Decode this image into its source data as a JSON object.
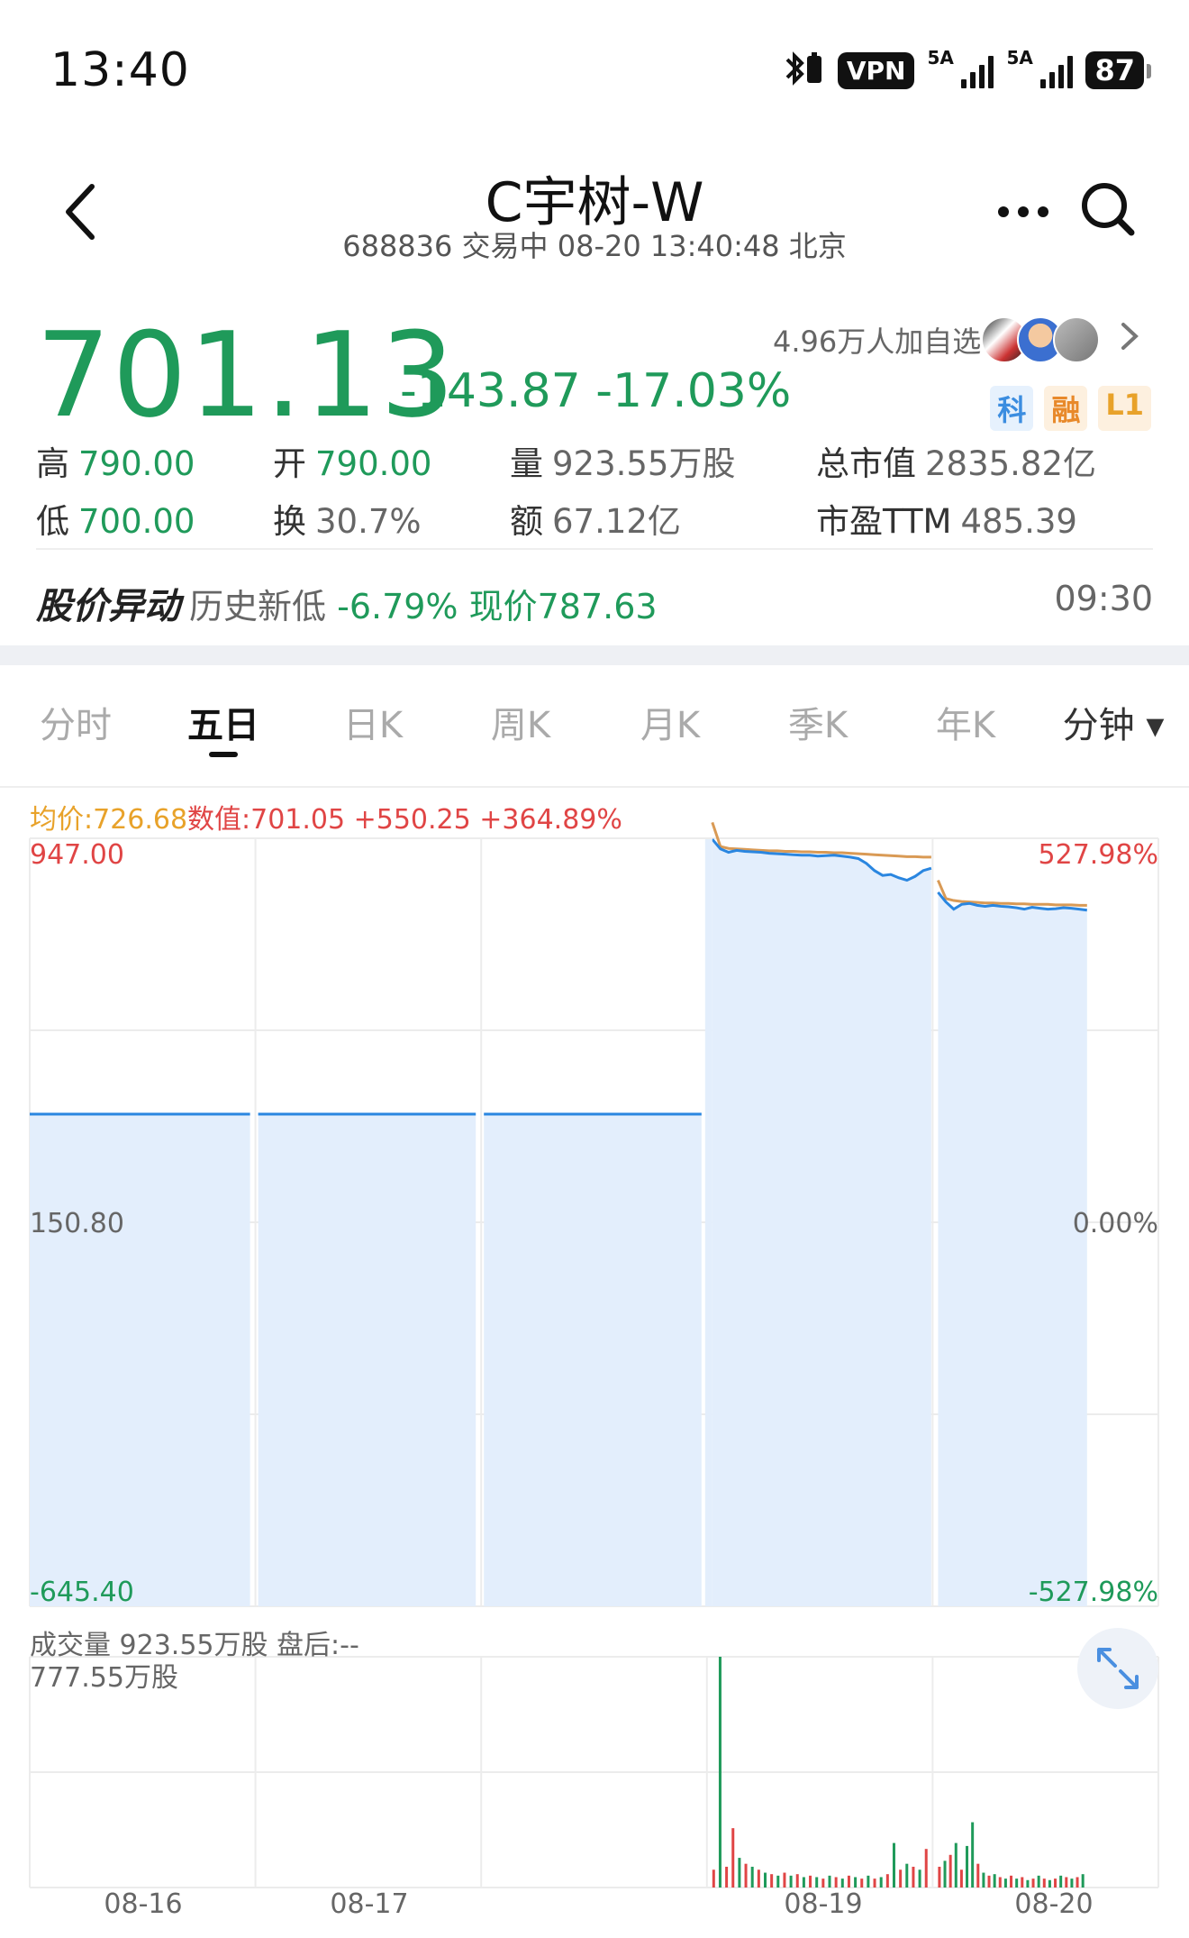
{
  "status_bar": {
    "time": "13:40",
    "vpn": "VPN",
    "signal1_label": "5A",
    "signal2_label": "5A",
    "battery": "87",
    "icons": [
      "bluetooth-icon",
      "vpn-icon",
      "signal-icon",
      "signal-icon",
      "battery-icon"
    ]
  },
  "header": {
    "title": "C宇树-W",
    "subtitle": "688836 交易中  08-20 13:40:48  北京"
  },
  "quote": {
    "price": "701.13",
    "change": "-143.87 -17.03%",
    "watch_count": "4.96万人加自选",
    "badges": [
      "科",
      "融",
      "L1"
    ],
    "stats": {
      "high_label": "高",
      "high_value": "790.00",
      "open_label": "开",
      "open_value": "790.00",
      "volume_label": "量",
      "volume_value": "923.55万股",
      "mktcap_label": "总市值",
      "mktcap_value": "2835.82亿",
      "low_label": "低",
      "low_value": "700.00",
      "turnover_label": "换",
      "turnover_value": "30.7%",
      "amount_label": "额",
      "amount_value": "67.12亿",
      "pe_label": "市盈TTM",
      "pe_value": "485.39"
    }
  },
  "alert": {
    "title": "股价异动",
    "text_gray": "历史新低",
    "text_green": "-6.79% 现价787.63",
    "time": "09:30"
  },
  "tabs": {
    "items": [
      "分时",
      "五日",
      "日K",
      "周K",
      "月K",
      "季K",
      "年K",
      "分钟 ▾"
    ],
    "active_index": 1
  },
  "chart_data": {
    "type": "line",
    "legend": {
      "avg": "均价:726.68",
      "value": "数值:701.05 +550.25 +364.89%"
    },
    "y_left_labels": {
      "top": "947.00",
      "mid": "150.80",
      "bottom": "-645.40"
    },
    "y_right_labels": {
      "top": "527.98%",
      "mid": "0.00%",
      "bottom": "-527.98%"
    },
    "ylim": [
      -645.4,
      947.0
    ],
    "colors": {
      "price": "#2a86e0",
      "avg": "#d99a55",
      "fill": "#e3eefc",
      "vol_up": "#e04545",
      "vol_down": "#1f9a5a"
    },
    "days": [
      "08-16",
      "08-17",
      "",
      "08-19",
      "08-20"
    ],
    "day_price_flat": [
      {
        "day": 0,
        "value": 375
      },
      {
        "day": 1,
        "value": 375
      },
      {
        "day": 2,
        "value": 375
      }
    ],
    "day4_price": [
      945,
      925,
      918,
      922,
      920,
      919,
      918,
      916,
      915,
      914,
      913,
      912,
      912,
      910,
      911,
      912,
      910,
      908,
      905,
      895,
      880,
      870,
      872,
      865,
      860,
      868,
      880,
      885
    ],
    "day4_avg": [
      980,
      930,
      926,
      925,
      924,
      923,
      922,
      921,
      921,
      920,
      920,
      919,
      919,
      918,
      918,
      917,
      917,
      916,
      915,
      914,
      913,
      912,
      911,
      910,
      909,
      909,
      908,
      908
    ],
    "day5_price": [
      835,
      815,
      800,
      810,
      812,
      808,
      806,
      808,
      806,
      805,
      803,
      800,
      804,
      802,
      800,
      801,
      803,
      802,
      800,
      798
    ],
    "day5_avg": [
      860,
      822,
      818,
      816,
      815,
      814,
      813,
      813,
      812,
      812,
      811,
      811,
      810,
      810,
      810,
      809,
      809,
      809,
      808,
      808
    ],
    "volume": {
      "label": "成交量 923.55万股   盘后:--",
      "max_label": "777.55万股",
      "max": 777.55,
      "day4": [
        60,
        777.55,
        70,
        200,
        100,
        80,
        70,
        60,
        50,
        45,
        40,
        50,
        40,
        45,
        35,
        40,
        35,
        30,
        40,
        35,
        30,
        40,
        35,
        30,
        40,
        30,
        35,
        45,
        150,
        60,
        80,
        70,
        60,
        130
      ],
      "day4_colors": [
        "r",
        "g",
        "r",
        "r",
        "g",
        "r",
        "g",
        "r",
        "g",
        "r",
        "g",
        "r",
        "g",
        "r",
        "g",
        "r",
        "g",
        "r",
        "g",
        "r",
        "g",
        "r",
        "g",
        "r",
        "g",
        "r",
        "g",
        "r",
        "g",
        "r",
        "g",
        "r",
        "g",
        "r"
      ],
      "day5": [
        70,
        90,
        110,
        150,
        60,
        140,
        220,
        80,
        50,
        40,
        45,
        35,
        30,
        40,
        30,
        35,
        25,
        30,
        40,
        30,
        25,
        30,
        40,
        35,
        30,
        35,
        45
      ],
      "day5_colors": [
        "r",
        "g",
        "r",
        "g",
        "r",
        "g",
        "g",
        "r",
        "g",
        "r",
        "g",
        "r",
        "g",
        "r",
        "g",
        "r",
        "g",
        "r",
        "g",
        "r",
        "g",
        "r",
        "g",
        "r",
        "g",
        "r",
        "g"
      ]
    }
  }
}
